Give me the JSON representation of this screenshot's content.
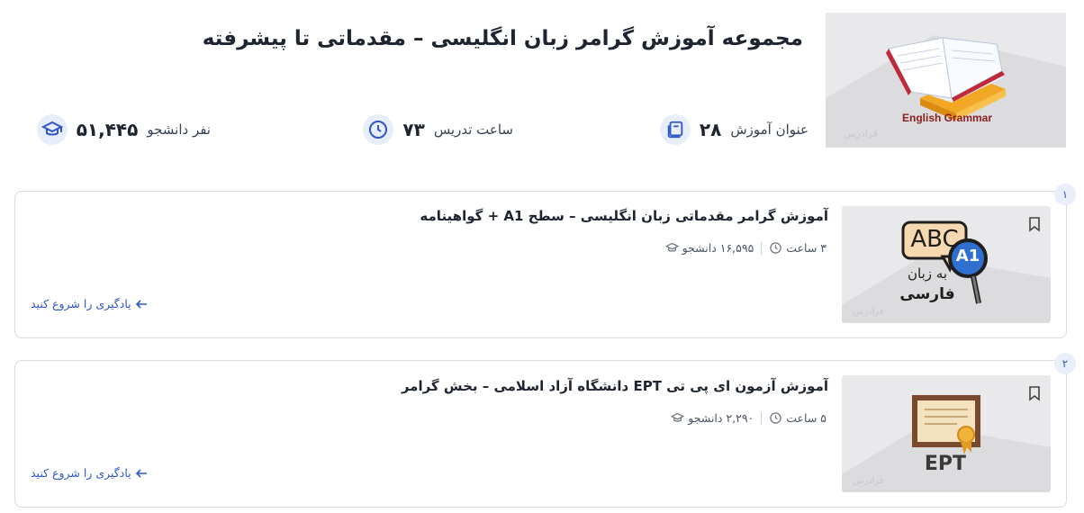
{
  "header": {
    "title": "مجموعه آموزش گرامر زبان انگلیسی – مقدماتی تا پیشرفته",
    "image_caption": "English Grammar",
    "watermark": "فرادرس",
    "stats": [
      {
        "icon": "book-stack-icon",
        "value": "۲۸",
        "label": "عنوان آموزش"
      },
      {
        "icon": "clock-icon",
        "value": "۷۳",
        "label": "ساعت تدریس"
      },
      {
        "icon": "graduation-cap-icon",
        "value": "۵۱,۴۴۵",
        "label": "نفر دانشجو"
      }
    ]
  },
  "courses": [
    {
      "index": "۱",
      "title": "آموزش گرامر مقدماتی زبان انگلیسی – سطح A1 + گواهینامه",
      "students": "۱۶,۵۹۵ دانشجو",
      "duration": "۳ ساعت",
      "cta": "یادگیری را شروع کنید",
      "thumb_text": {
        "abc": "ABC",
        "badge": "A1",
        "line1": "به زبان",
        "line2": "فارسی"
      }
    },
    {
      "index": "۲",
      "title": "آموزش آزمون ای پی تی EPT دانشگاه آزاد اسلامی – بخش گرامر",
      "students": "۲,۲۹۰ دانشجو",
      "duration": "۵ ساعت",
      "cta": "یادگیری را شروع کنید",
      "thumb_text": {
        "label": "EPT"
      }
    }
  ],
  "colors": {
    "accent": "#2f56c9",
    "icon_bg": "#e7edf9",
    "border": "#d9dce1"
  }
}
